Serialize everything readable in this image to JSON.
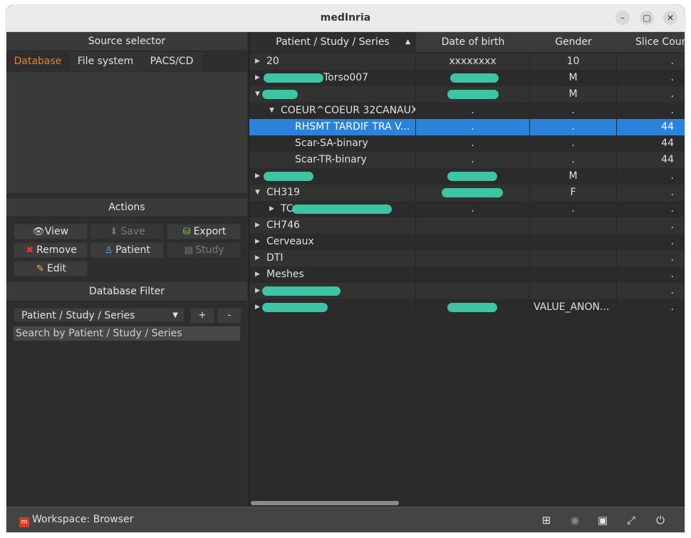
{
  "window": {
    "title": "medInria",
    "minimize_icon": "minimize-icon",
    "maximize_icon": "maximize-icon",
    "close_icon": "close-icon"
  },
  "source_selector": {
    "heading": "Source selector",
    "tabs": [
      "Database",
      "File system",
      "PACS/CD"
    ],
    "active_tab": "Database"
  },
  "actions": {
    "heading": "Actions",
    "buttons": [
      {
        "label": "View",
        "icon": "eye-icon",
        "enabled": true
      },
      {
        "label": "Save",
        "icon": "save-icon",
        "enabled": false
      },
      {
        "label": "Export",
        "icon": "export-icon",
        "enabled": true
      },
      {
        "label": "Remove",
        "icon": "x-icon",
        "enabled": true
      },
      {
        "label": "Patient",
        "icon": "patient-icon",
        "enabled": true
      },
      {
        "label": "Study",
        "icon": "study-icon",
        "enabled": false
      },
      {
        "label": "Edit",
        "icon": "edit-icon",
        "enabled": true
      }
    ]
  },
  "filter": {
    "heading": "Database Filter",
    "combo_value": "Patient / Study / Series",
    "add_label": "+",
    "remove_label": "-",
    "search_placeholder": "Search by Patient / Study / Series"
  },
  "table": {
    "headers": [
      "Patient / Study / Series",
      "Date of birth",
      "Gender",
      "Slice Coun"
    ],
    "sort_indicator": "▲",
    "rows": [
      {
        "indent": 0,
        "expander": "collapsed",
        "name": "20",
        "dob": "xxxxxxxx",
        "gender": "10",
        "slices": "."
      },
      {
        "indent": 0,
        "expander": "collapsed",
        "name": "Torso007",
        "dob": "",
        "gender": "M",
        "slices": "."
      },
      {
        "indent": 0,
        "expander": "expanded",
        "name": "",
        "dob": "",
        "gender": "M",
        "slices": "."
      },
      {
        "indent": 1,
        "expander": "expanded",
        "name": "COEUR^COEUR 32CANAUX",
        "dob": ".",
        "gender": ".",
        "slices": "."
      },
      {
        "indent": 2,
        "expander": "none",
        "name": "RHSMT TARDIF TRA V...",
        "dob": ".",
        "gender": ".",
        "slices": "44",
        "selected": true
      },
      {
        "indent": 2,
        "expander": "none",
        "name": "Scar-SA-binary",
        "dob": ".",
        "gender": ".",
        "slices": "44"
      },
      {
        "indent": 2,
        "expander": "none",
        "name": "Scar-TR-binary",
        "dob": ".",
        "gender": ".",
        "slices": "44"
      },
      {
        "indent": 0,
        "expander": "collapsed",
        "name": "",
        "dob": "",
        "gender": "M",
        "slices": "."
      },
      {
        "indent": 0,
        "expander": "expanded",
        "name": "CH319",
        "dob": "",
        "gender": "F",
        "slices": "."
      },
      {
        "indent": 1,
        "expander": "collapsed",
        "name": "TC",
        "dob": ".",
        "gender": ".",
        "slices": "."
      },
      {
        "indent": 0,
        "expander": "collapsed",
        "name": "CH746",
        "dob": "",
        "gender": "",
        "slices": "."
      },
      {
        "indent": 0,
        "expander": "collapsed",
        "name": "Cerveaux",
        "dob": "",
        "gender": "",
        "slices": "."
      },
      {
        "indent": 0,
        "expander": "collapsed",
        "name": "DTI",
        "dob": "",
        "gender": "",
        "slices": "."
      },
      {
        "indent": 0,
        "expander": "collapsed",
        "name": "Meshes",
        "dob": "",
        "gender": "",
        "slices": "."
      },
      {
        "indent": 0,
        "expander": "collapsed",
        "name": "",
        "dob": "",
        "gender": "",
        "slices": "."
      },
      {
        "indent": 0,
        "expander": "collapsed",
        "name": "",
        "dob": "",
        "gender": "VALUE_ANON...",
        "slices": "."
      }
    ]
  },
  "statusbar": {
    "workspace_label": "Workspace: Browser",
    "icons": [
      "layout-icon",
      "camera-icon",
      "movie-icon",
      "fullscreen-icon",
      "power-icon"
    ]
  },
  "colors": {
    "accent": "#f07f2e",
    "selection": "#2a82da",
    "redaction": "#3cc4a3"
  }
}
